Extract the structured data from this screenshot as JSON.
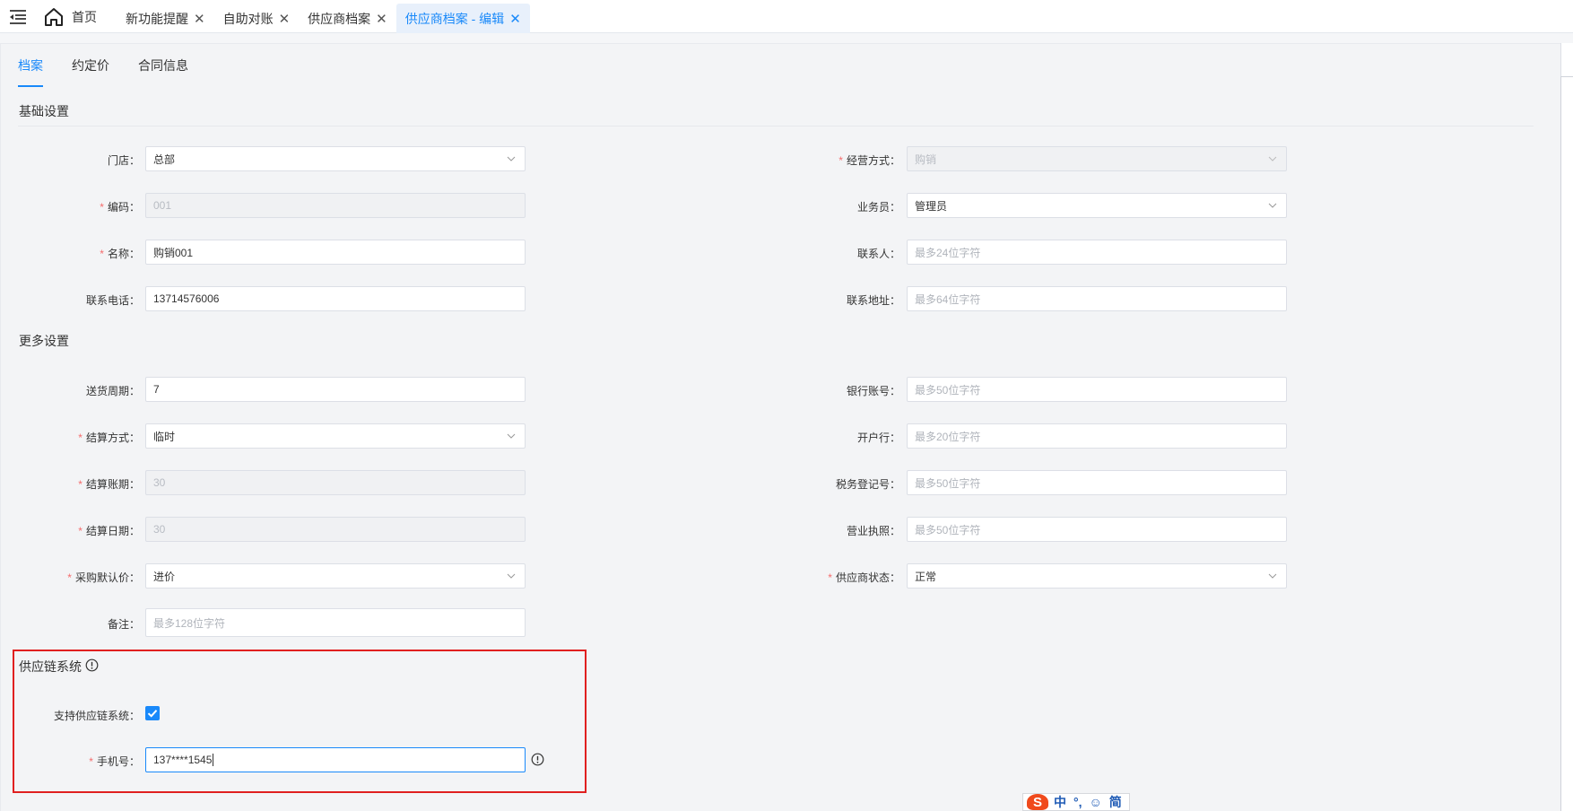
{
  "topbar": {
    "home_label": "首页",
    "tabs": [
      {
        "label": "新功能提醒",
        "close": "✕"
      },
      {
        "label": "自助对账",
        "close": "✕"
      },
      {
        "label": "供应商档案",
        "close": "✕"
      },
      {
        "label": "供应商档案 - 编辑",
        "close": "✕",
        "active": true
      }
    ]
  },
  "subtabs": [
    "档案",
    "约定价",
    "合同信息"
  ],
  "sections": {
    "basic": "基础设置",
    "more": "更多设置",
    "supply_chain": "供应链系统"
  },
  "basic_left": {
    "store": {
      "label": "门店",
      "value": "总部"
    },
    "code": {
      "label": "编码",
      "value": "001"
    },
    "name": {
      "label": "名称",
      "value": "购销001"
    },
    "phone": {
      "label": "联系电话",
      "value": "13714576006"
    }
  },
  "basic_right": {
    "mode": {
      "label": "经营方式",
      "value": "购销"
    },
    "salesman": {
      "label": "业务员",
      "value": "管理员"
    },
    "contact": {
      "label": "联系人",
      "placeholder": "最多24位字符"
    },
    "address": {
      "label": "联系地址",
      "placeholder": "最多64位字符"
    }
  },
  "more_left": {
    "cycle": {
      "label": "送货周期",
      "value": "7"
    },
    "settle_method": {
      "label": "结算方式",
      "value": "临时"
    },
    "settle_period": {
      "label": "结算账期",
      "value": "30"
    },
    "settle_date": {
      "label": "结算日期",
      "value": "30"
    },
    "purchase_price": {
      "label": "采购默认价",
      "value": "进价"
    },
    "remark": {
      "label": "备注",
      "placeholder": "最多128位字符"
    }
  },
  "more_right": {
    "bank_account": {
      "label": "银行账号",
      "placeholder": "最多50位字符"
    },
    "bank_name": {
      "label": "开户行",
      "placeholder": "最多20位字符"
    },
    "tax_no": {
      "label": "税务登记号",
      "placeholder": "最多50位字符"
    },
    "license": {
      "label": "营业执照",
      "placeholder": "最多50位字符"
    },
    "status": {
      "label": "供应商状态",
      "value": "正常"
    }
  },
  "supply_chain": {
    "support_label": "支持供应链系统",
    "support_checked": true,
    "mobile_label": "手机号",
    "mobile_value": "137****1545"
  },
  "colon": "：",
  "required_mark": "*",
  "ime": {
    "logo": "S",
    "items": [
      "中",
      "°,",
      "☺",
      "简"
    ]
  },
  "colors": {
    "accent": "#1989fa",
    "required": "#f56c6c",
    "highlight": "#e02020"
  }
}
